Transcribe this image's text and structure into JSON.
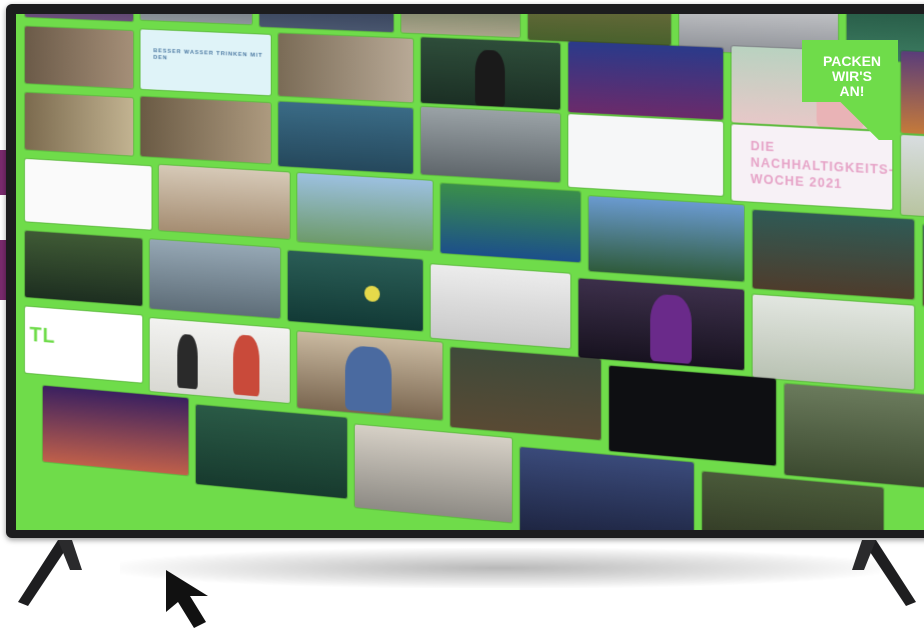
{
  "scene": {
    "badge_lines": [
      "PACKEN",
      "WIR'S",
      "AN!"
    ],
    "tile_titles": {
      "t_blue": "BESSER WASSER TRINKEN MIT DEN",
      "t_pink": "DIE NACHHALTIGKEITS-WOCHE 2021",
      "t_green": "TL"
    },
    "colors": {
      "grid_green": "#6fdc4a",
      "tv_frame": "#1c1c1e",
      "accent_purple": "#7a2a6e"
    }
  }
}
